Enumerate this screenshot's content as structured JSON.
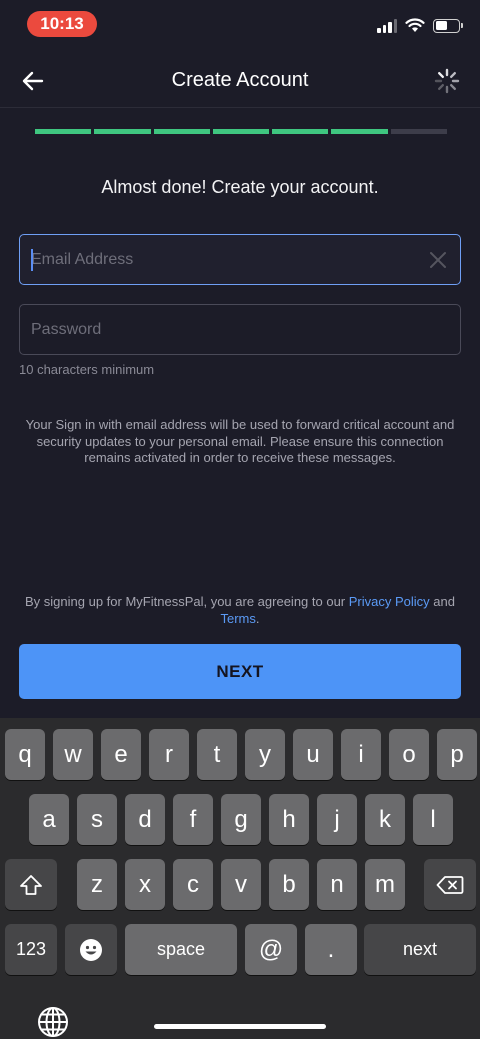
{
  "status": {
    "time": "10:13"
  },
  "nav": {
    "title": "Create Account"
  },
  "progress": {
    "total_segments": 7,
    "completed_segments": 6,
    "color_done": "#3fc680",
    "color_todo": "#3d3d4a"
  },
  "heading": "Almost done! Create your account.",
  "email": {
    "placeholder": "Email Address",
    "value": ""
  },
  "password": {
    "placeholder": "Password",
    "value": "",
    "helper": "10 characters minimum"
  },
  "info_text": "Your Sign in with email address will be used to forward critical account and security updates to your personal email. Please ensure this connection remains activated in order to receive these messages.",
  "terms": {
    "prefix": "By signing up for MyFitnessPal, you are agreeing to our ",
    "privacy_link": "Privacy Policy",
    "middle": " and ",
    "terms_link": "Terms",
    "suffix": "."
  },
  "next_button": "NEXT",
  "keyboard": {
    "row1": [
      "q",
      "w",
      "e",
      "r",
      "t",
      "y",
      "u",
      "i",
      "o",
      "p"
    ],
    "row2": [
      "a",
      "s",
      "d",
      "f",
      "g",
      "h",
      "j",
      "k",
      "l"
    ],
    "row3": [
      "z",
      "x",
      "c",
      "v",
      "b",
      "n",
      "m"
    ],
    "numbers_key": "123",
    "space_key": "space",
    "at_key": "@",
    "dot_key": ".",
    "next_key": "next"
  },
  "colors": {
    "accent": "#4d94f7",
    "link": "#5b9af5",
    "focus_border": "#6f9ff5",
    "time_pill": "#eb4a3e"
  }
}
